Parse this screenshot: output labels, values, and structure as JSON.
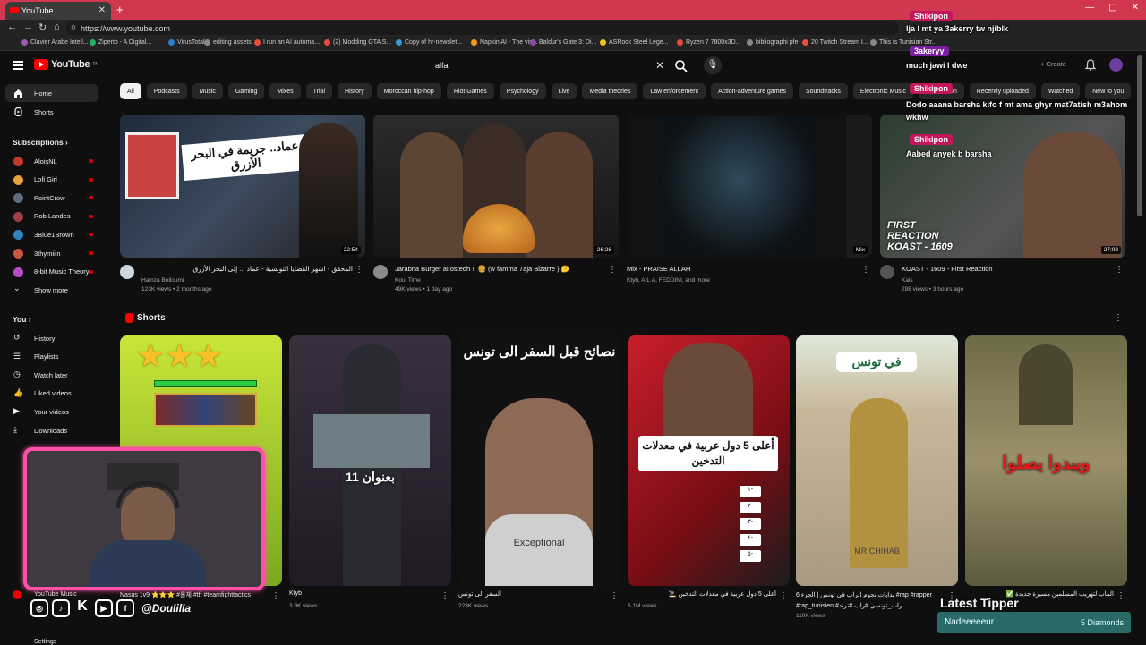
{
  "browser": {
    "tab_title": "YouTube",
    "new_tab_label": "+",
    "url": "https://www.youtube.com",
    "window_controls": [
      "—",
      "▢",
      "✕"
    ],
    "bookmarks": [
      {
        "label": "Clavier Arabe Intell...",
        "color": "#9b59b6"
      },
      {
        "label": "Ziperto - A Digital...",
        "color": "#27ae60"
      },
      {
        "label": "VirusTotal",
        "color": "#2c82c9"
      },
      {
        "label": "editing assets",
        "color": "#888888"
      },
      {
        "label": "I run an AI automa...",
        "color": "#e74c3c"
      },
      {
        "label": "(2) Modding GTA S...",
        "color": "#e74c3c"
      },
      {
        "label": "Copy of hr-newslet...",
        "color": "#3498db"
      },
      {
        "label": "Napkin AI - The vis...",
        "color": "#f39c12"
      },
      {
        "label": "Baldur's Gate 3: Di...",
        "color": "#8e44ad"
      },
      {
        "label": "ASRock Steel Lege...",
        "color": "#f1c40f"
      },
      {
        "label": "Ryzen 7 7800x3D...",
        "color": "#e74c3c"
      },
      {
        "label": "bibliographi pfe",
        "color": "#888888"
      },
      {
        "label": "20 Twitch Stream I...",
        "color": "#e74c3c"
      },
      {
        "label": "This is Tunisian Str...",
        "color": "#888888"
      }
    ]
  },
  "header": {
    "logo_text": "YouTube",
    "logo_sup": "TN",
    "search_value": "alfa",
    "clear_label": "✕",
    "mic_label": "🎙",
    "create_label": "+ Create"
  },
  "chips": [
    "All",
    "Podcasts",
    "Music",
    "Gaming",
    "Mixes",
    "Trial",
    "History",
    "Moroccan hip-hop",
    "Riot Games",
    "Psychology",
    "Live",
    "Media theories",
    "Law enforcement",
    "Action-adventure games",
    "Soundtracks",
    "Electronic Music",
    "Information",
    "Recently uploaded",
    "Watched",
    "New to you"
  ],
  "sidebar": {
    "home": "Home",
    "shorts": "Shorts",
    "subscriptions_header": "Subscriptions",
    "subscriptions": [
      {
        "name": "AloisNL",
        "color": "#c0392b"
      },
      {
        "name": "Lofi Girl",
        "color": "#e8a33a"
      },
      {
        "name": "PointCrow",
        "color": "#5d6d7e"
      },
      {
        "name": "Rob Landes",
        "color": "#a04040"
      },
      {
        "name": "3Blue1Brown",
        "color": "#2e86c1"
      },
      {
        "name": "3thymiiin",
        "color": "#cc5544"
      },
      {
        "name": "8-bit Music Theory",
        "color": "#b84dcc"
      }
    ],
    "show_more": "Show more",
    "you_header": "You",
    "you_items": [
      "History",
      "Playlists",
      "Watch later",
      "Liked videos",
      "Your videos",
      "Downloads"
    ],
    "youtube_music": "YouTube Music",
    "settings": "Settings"
  },
  "videos": [
    {
      "title": "المحقق - اشهر القضايا التونسية - عماد ... إلى البحر الأزرق",
      "channel": "Hamza Belloumi",
      "meta": "123K views • 2 months ago",
      "duration": "22:54",
      "thumb_text": "عماد.. جريمة في البحر الأزرق",
      "avatar_color": "#cfd8dc"
    },
    {
      "title": "Jarabna Burger al ostedh !! 🍔 (w famma 7aja Bizarre ) 🤔",
      "channel": "Koul Time",
      "meta": "49K views • 1 day ago",
      "duration": "26:28",
      "thumb_text": "",
      "avatar_color": "#8a8a8a"
    },
    {
      "title": "Mix - PRAISE ALLAH",
      "channel": "Ktyb, A.L.A, FEDDINI, and more",
      "meta": "",
      "duration": "Mix",
      "thumb_text": "",
      "avatar_color": ""
    },
    {
      "title": "KOAST - 1609 - First Reaction",
      "channel": "Kais",
      "meta": "298 views • 3 hours ago",
      "duration": "27:08",
      "thumb_text": "FIRST REACTION KOAST - 1609",
      "avatar_color": "#555555"
    }
  ],
  "shorts_header": "Shorts",
  "shorts": [
    {
      "title": "Nasus 1v9 ⭐⭐⭐ #롤체 #tft #teamfighttactics",
      "views": "",
      "overlay": ""
    },
    {
      "title": "Ktyb",
      "views": "3.9K views",
      "overlay": "بعنوان 11"
    },
    {
      "title": "السفر الى تونس",
      "views": "223K views",
      "overlay": "نصائح قبل السفر الى تونس",
      "shirt": "Exceptional"
    },
    {
      "title": "أعلى 5 دول عربية في معدلات التدخين 🚬",
      "views": "5.1M views",
      "overlay": "أعلى 5 دول عربية في معدلات التدخين",
      "list": [
        "١-",
        "٢-",
        "٣-",
        "٤-",
        "٥-"
      ]
    },
    {
      "title": "6 بدايات نجوم الراب في تونس | الجزء #rap #rapper #rap_tunisien #راب_تونسي #راب #ترند",
      "views": "110K views",
      "overlay": "في تونس",
      "caption": "MR CHIHAB"
    },
    {
      "title": "الماب لتهريب المسلمين مسيرة جديدة ✅",
      "views": "",
      "overlay": "ويبدوا يصلوا"
    }
  ],
  "chat": [
    {
      "name": "Shikipon",
      "message": "lja l mt ya 3akerry tw njiblk",
      "name_color": "#c2185b"
    },
    {
      "name": "3akeryy",
      "message": "much jawi l dwe",
      "name_color": "#7b1fa2"
    },
    {
      "name": "Shikipon",
      "message": "Dodo aaana barsha kifo f mt ama ghyr mat7atish m3ahom wkhw",
      "name_color": "#c2185b"
    },
    {
      "name": "Shikipon",
      "message": "Aabed anyek b barsha",
      "name_color": "#c2185b"
    }
  ],
  "overlay": {
    "handle": "@Doulilla",
    "tipper_title": "Latest Tipper",
    "tipper_name": "Nadeeeeeur",
    "tipper_amount": "5 Diamonds"
  }
}
